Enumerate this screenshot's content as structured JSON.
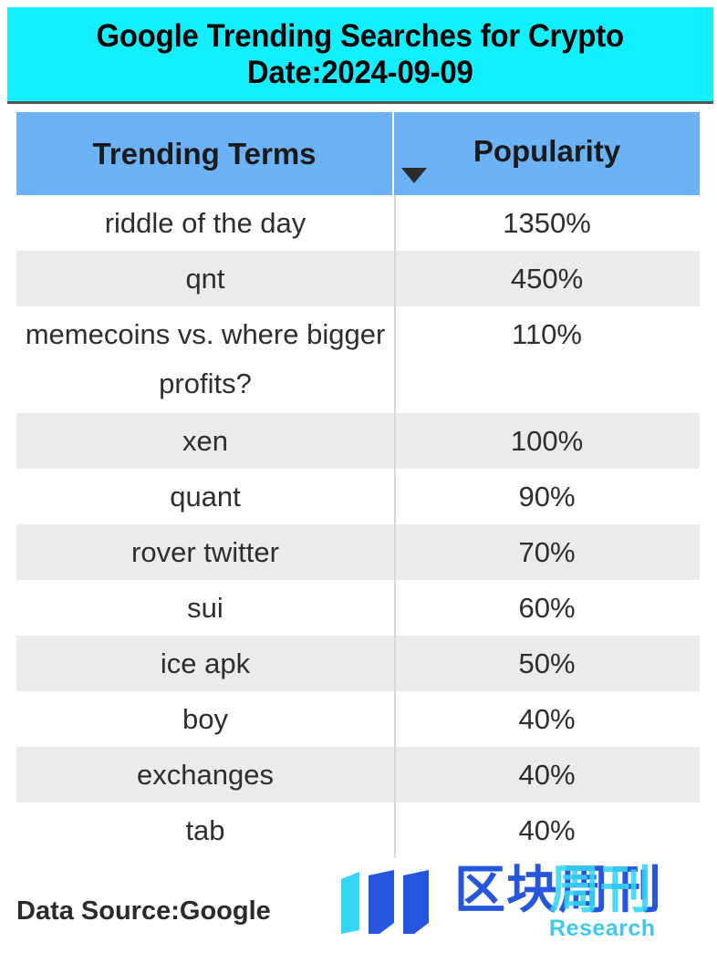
{
  "title": {
    "line1": "Google Trending Searches for Crypto",
    "line2": "Date:2024-09-09",
    "background_color": "#14EFFF",
    "text_color": "#000000"
  },
  "table": {
    "header": {
      "terms_label": "Trending Terms",
      "popularity_label": "Popularity",
      "sort_icon": "triangle-down-icon",
      "sort_direction": "descending",
      "background_color": "#6CB2F7"
    },
    "columns": [
      "Trending Terms",
      "Popularity"
    ],
    "row_colors": {
      "odd": "#FFFFFF",
      "even": "#EBEBEB"
    },
    "rows": [
      {
        "term": "riddle of the day",
        "popularity": "1350%"
      },
      {
        "term": "qnt",
        "popularity": "450%"
      },
      {
        "term": "memecoins vs. where bigger profits?",
        "popularity": "110%"
      },
      {
        "term": "xen",
        "popularity": "100%"
      },
      {
        "term": "quant",
        "popularity": "90%"
      },
      {
        "term": "rover twitter",
        "popularity": "70%"
      },
      {
        "term": "sui",
        "popularity": "60%"
      },
      {
        "term": "ice apk",
        "popularity": "50%"
      },
      {
        "term": "boy",
        "popularity": "40%"
      },
      {
        "term": "exchanges",
        "popularity": "40%"
      },
      {
        "term": "tab",
        "popularity": "40%"
      }
    ]
  },
  "footer": {
    "data_source": "Data Source:Google",
    "logo": {
      "mark_icon": "three-bars-logo-icon",
      "chinese_name": "区块周刊",
      "overlay_text": "周刊",
      "subtitle": "Research",
      "primary_color": "#2656DC",
      "accent_color": "#35D6F5"
    }
  },
  "chart_data": {
    "type": "table",
    "title": "Google Trending Searches for Crypto Date:2024-09-09",
    "columns": [
      "Trending Terms",
      "Popularity"
    ],
    "categories": [
      "riddle of the day",
      "qnt",
      "memecoins vs. where bigger profits?",
      "xen",
      "quant",
      "rover twitter",
      "sui",
      "ice apk",
      "boy",
      "exchanges",
      "tab"
    ],
    "values": [
      1350,
      450,
      110,
      100,
      90,
      70,
      60,
      50,
      40,
      40,
      40
    ],
    "value_labels": [
      "1350%",
      "450%",
      "110%",
      "100%",
      "90%",
      "70%",
      "60%",
      "50%",
      "40%",
      "40%",
      "40%"
    ],
    "unit": "%",
    "xlabel": "Trending Terms",
    "ylabel": "Popularity",
    "sorted_by": "Popularity",
    "sort_order": "descending"
  }
}
